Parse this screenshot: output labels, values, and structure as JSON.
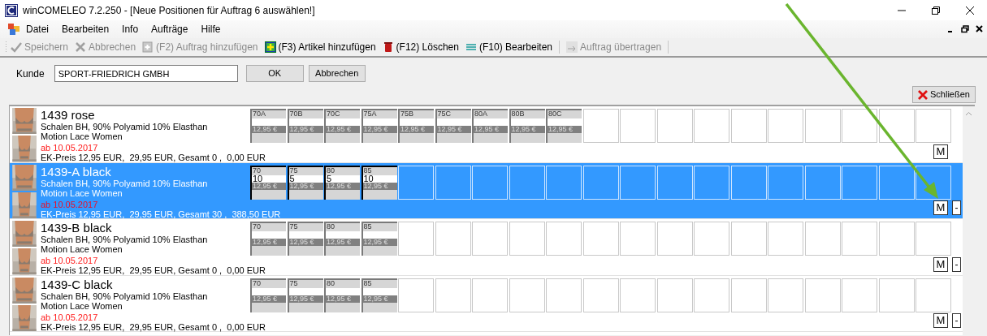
{
  "window": {
    "title": "winCOMELEO 7.2.250 - [Neue Positionen für Auftrag 6 auswählen!]"
  },
  "menu": [
    {
      "label": "Datei"
    },
    {
      "label": "Bearbeiten"
    },
    {
      "label": "Info"
    },
    {
      "label": "Aufträge"
    },
    {
      "label": "Hilfe"
    }
  ],
  "toolbar": [
    {
      "label": "Speichern",
      "disabled": true
    },
    {
      "label": "Abbrechen",
      "disabled": true
    },
    {
      "label": "(F2) Auftrag hinzufügen",
      "disabled": true
    },
    {
      "label": "(F3) Artikel hinzufügen",
      "disabled": false
    },
    {
      "label": "(F12) Löschen",
      "disabled": false
    },
    {
      "label": "(F10) Bearbeiten",
      "disabled": false
    },
    {
      "label": "Auftrag übertragen",
      "disabled": true
    }
  ],
  "customer": {
    "label": "Kunde",
    "value": "SPORT-FRIEDRICH GMBH",
    "buttons": [
      "OK",
      "Abbrechen"
    ]
  },
  "close_button": "Schließen",
  "articles": [
    {
      "title": "1439 rose",
      "description": "Schalen BH, 90% Polyamid 10% Elasthan",
      "collection": "Motion Lace Women",
      "date": "ab 10.05.2017",
      "price_line": "EK-Preis 12,95 EUR,  29,95 EUR, Gesamt 0 ,  0,00 EUR",
      "selected": false,
      "m_button": "M",
      "sizes": [
        {
          "size": "70A",
          "price": "12,95 €"
        },
        {
          "size": "70B",
          "price": "12,95 €"
        },
        {
          "size": "70C",
          "price": "12,95 €"
        },
        {
          "size": "75A",
          "price": "12,95 €"
        },
        {
          "size": "75B",
          "price": "12,95 €"
        },
        {
          "size": "75C",
          "price": "12,95 €"
        },
        {
          "size": "80A",
          "price": "12,95 €"
        },
        {
          "size": "80B",
          "price": "12,95 €"
        },
        {
          "size": "80C",
          "price": "12,95 €"
        }
      ]
    },
    {
      "title": "1439-A black",
      "description": "Schalen BH, 90% Polyamid 10% Elasthan",
      "collection": "Motion Lace Women",
      "date": "ab 10.05.2017",
      "price_line": "EK-Preis 12,95 EUR,  29,95 EUR, Gesamt 30 ,  388,50 EUR",
      "selected": true,
      "m_button": "M",
      "minus_button": "-",
      "sizes": [
        {
          "size": "70",
          "quantity": "10",
          "price": "12,95 €"
        },
        {
          "size": "75",
          "quantity": "5",
          "price": "12,95 €"
        },
        {
          "size": "80",
          "quantity": "5",
          "price": "12,95 €"
        },
        {
          "size": "85",
          "quantity": "10",
          "price": "12,95 €"
        }
      ]
    },
    {
      "title": "1439-B black",
      "description": "Schalen BH, 90% Polyamid 10% Elasthan",
      "collection": "Motion Lace Women",
      "date": "ab 10.05.2017",
      "price_line": "EK-Preis 12,95 EUR,  29,95 EUR, Gesamt 0 ,  0,00 EUR",
      "selected": false,
      "m_button": "M",
      "minus_button": "-",
      "sizes": [
        {
          "size": "70",
          "price": "12,95 €"
        },
        {
          "size": "75",
          "price": "12,95 €"
        },
        {
          "size": "80",
          "price": "12,95 €"
        },
        {
          "size": "85",
          "price": "12,95 €"
        }
      ]
    },
    {
      "title": "1439-C black",
      "description": "Schalen BH, 90% Polyamid 10% Elasthan",
      "collection": "Motion Lace Women",
      "date": "ab 10.05.2017",
      "price_line": "EK-Preis 12,95 EUR,  29,95 EUR, Gesamt 0 ,  0,00 EUR",
      "selected": false,
      "m_button": "M",
      "minus_button": "-",
      "sizes": [
        {
          "size": "70",
          "price": "12,95 €"
        },
        {
          "size": "75",
          "price": "12,95 €"
        },
        {
          "size": "80",
          "price": "12,95 €"
        },
        {
          "size": "85",
          "price": "12,95 €"
        }
      ]
    }
  ],
  "annotations": [
    {
      "kind": "arrow"
    }
  ]
}
